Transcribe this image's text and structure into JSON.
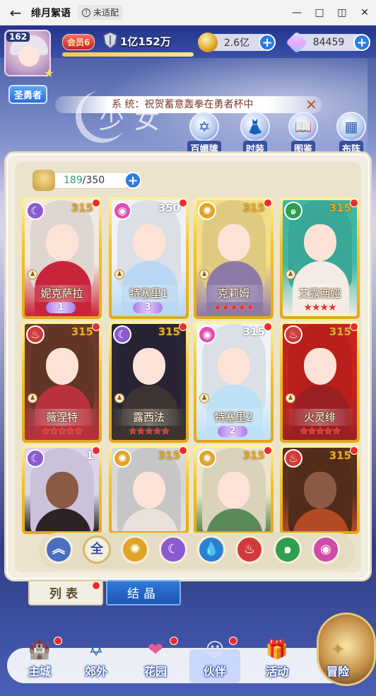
{
  "window": {
    "title": "绯月絮语",
    "badge": "未适配",
    "back_icon": "arrow-left-icon",
    "controls": [
      "minimize-icon",
      "maximize-icon",
      "sidebar-icon",
      "close-icon"
    ]
  },
  "player": {
    "level": "162",
    "vip": "会员6",
    "power": "1亿152万",
    "title": "圣勇者",
    "exp_percent": 100
  },
  "resources": {
    "gold": "2.6亿",
    "diamond": "84459"
  },
  "notice": {
    "text": "系 统：祝贺蓄意轰拳在勇者杯中"
  },
  "background_text": "少女",
  "features": [
    {
      "label": "百媚牌",
      "icon": "star-of-david-icon"
    },
    {
      "label": "时装",
      "icon": "dress-icon"
    },
    {
      "label": "图鉴",
      "icon": "book-icon"
    },
    {
      "label": "布阵",
      "icon": "grid-icon"
    }
  ],
  "capacity": {
    "current": "189",
    "max": "/350"
  },
  "cards": [
    {
      "name": "妮克萨拉",
      "level": "315",
      "element": "moon",
      "badge": "rank",
      "rank": "1"
    },
    {
      "name": "特塞里1",
      "level": "350",
      "element": "pink",
      "badge": "rank",
      "rank": "3"
    },
    {
      "name": "克莉姆",
      "level": "315",
      "element": "sun",
      "badge": "stars",
      "stars": "★★★★★"
    },
    {
      "name": "艾露西娅",
      "level": "315",
      "element": "wind",
      "badge": "stars",
      "stars": "★★★★"
    },
    {
      "name": "薇涅特",
      "level": "315",
      "element": "fire",
      "badge": "stars",
      "stars": "★★★★★"
    },
    {
      "name": "露西法",
      "level": "315",
      "element": "moon",
      "badge": "stars",
      "stars": "★★★★★"
    },
    {
      "name": "特塞里2",
      "level": "315",
      "element": "pink",
      "badge": "rank",
      "rank": "2"
    },
    {
      "name": "火灵绯",
      "level": "315",
      "element": "fire",
      "badge": "stars",
      "stars": "★★★★★"
    },
    {
      "name": "",
      "level": "1",
      "element": "moon",
      "badge": "none"
    },
    {
      "name": "",
      "level": "315",
      "element": "sun",
      "badge": "none"
    },
    {
      "name": "",
      "level": "315",
      "element": "sun",
      "badge": "none"
    },
    {
      "name": "",
      "level": "315",
      "element": "fire",
      "badge": "none"
    }
  ],
  "filters": [
    {
      "label": "",
      "icon": "light-icon",
      "color": "#4a6fc0"
    },
    {
      "label": "全",
      "icon": "all-icon",
      "color": "#f3eee2"
    },
    {
      "label": "",
      "icon": "sun-icon",
      "color": "#e0a526"
    },
    {
      "label": "",
      "icon": "moon-icon",
      "color": "#8a5bd0"
    },
    {
      "label": "",
      "icon": "water-icon",
      "color": "#2b7fd3"
    },
    {
      "label": "",
      "icon": "fire-icon",
      "color": "#d23a3a"
    },
    {
      "label": "",
      "icon": "wind-icon",
      "color": "#2f9e50"
    },
    {
      "label": "",
      "icon": "pink-orb-icon",
      "color": "#d04aa8"
    }
  ],
  "tabs": {
    "list": "列表",
    "crystal": "结晶"
  },
  "nav": [
    {
      "label": "主城",
      "icon": "castle-icon",
      "dot": true
    },
    {
      "label": "郊外",
      "icon": "compass-icon",
      "dot": false
    },
    {
      "label": "花园",
      "icon": "heart-icon",
      "dot": true
    },
    {
      "label": "伙伴",
      "icon": "partner-icon",
      "dot": true
    },
    {
      "label": "活动",
      "icon": "gift-icon",
      "dot": false
    },
    {
      "label": "冒险",
      "icon": "adventure-icon",
      "dot": false
    }
  ],
  "colors": {
    "accent_blue": "#2d7be0",
    "notify_red": "#ee2b2b",
    "card_gold": "#f0c52a"
  }
}
